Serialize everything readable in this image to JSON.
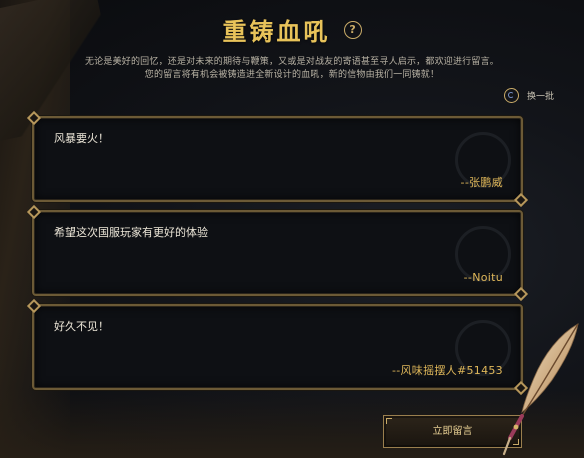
{
  "header": {
    "title": "重铸血吼",
    "help_glyph": "?",
    "desc_line1": "无论是美好的回忆，还是对未来的期待与鞭策，又或是对战友的寄语甚至寻人启示，都欢迎进行留言。",
    "desc_line2": "您的留言将有机会被铸造进全新设计的血吼，新的信物由我们一同铸就！"
  },
  "refresh": {
    "label": "换一批",
    "icon": "refresh-icon"
  },
  "messages": [
    {
      "text": "风暴要火！",
      "author": "--张鹏威"
    },
    {
      "text": "希望这次国服玩家有更好的体验",
      "author": "--Noitu"
    },
    {
      "text": "好久不见！",
      "author": "--风味摇摆人#51453"
    }
  ],
  "submit": {
    "label": "立即留言"
  },
  "colors": {
    "accent_gold": "#e8c35a",
    "author_gold": "#e0b85a",
    "card_border": "#6c5a36",
    "background": "#121419"
  },
  "icons": {
    "help": "question-circle-icon",
    "quill": "quill-pen-icon"
  }
}
